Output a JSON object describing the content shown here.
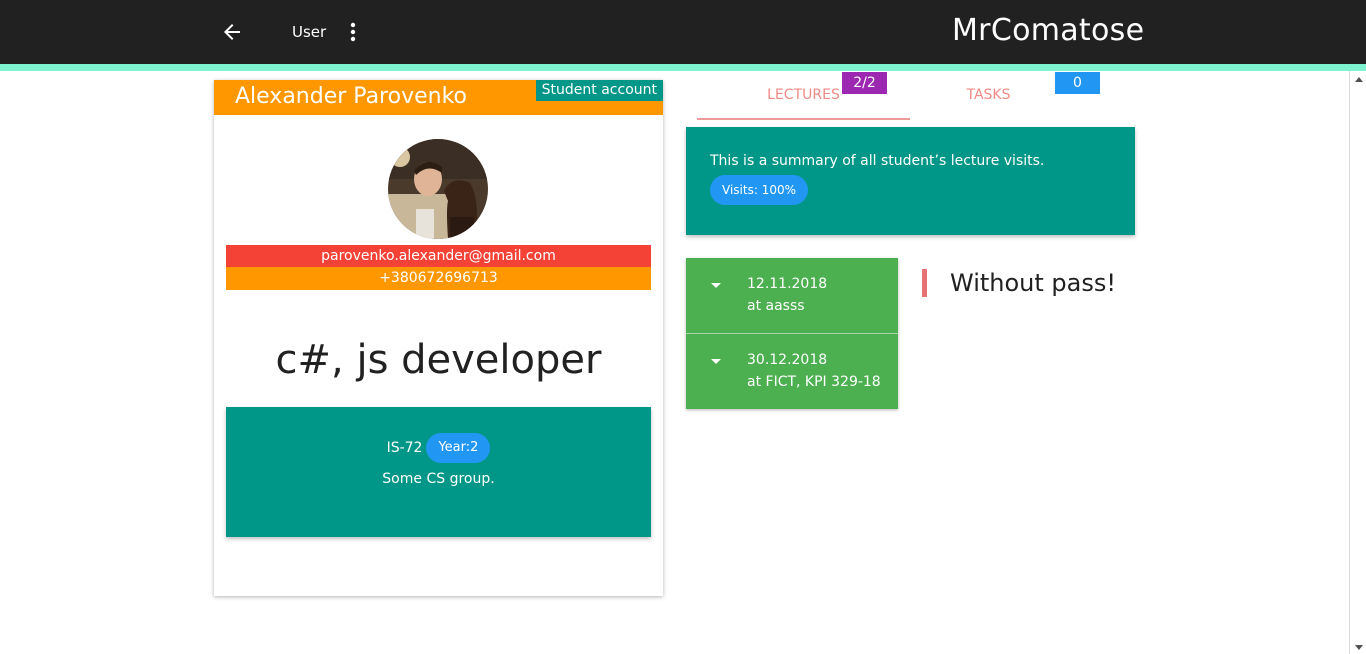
{
  "header": {
    "user_label": "User",
    "brand": "MrComatose"
  },
  "profile": {
    "name": "Alexander Parovenko",
    "account_badge": "Student account",
    "email": "parovenko.alexander@gmail.com",
    "phone": "+380672696713",
    "headline": "c#, js developer",
    "group": {
      "name": "IS-72",
      "year_chip": "Year:2",
      "description": "Some CS group."
    }
  },
  "tabs": [
    {
      "label": "LECTURES",
      "badge": "2/2"
    },
    {
      "label": "TASKS",
      "badge": "0"
    }
  ],
  "summary": {
    "text": "This is a summary of all student’s lecture visits.",
    "visits": "Visits: 100%"
  },
  "lectures": [
    {
      "date": "12.11.2018",
      "place": "at aasss"
    },
    {
      "date": "30.12.2018",
      "place": "at FICT, KPI 329-18"
    }
  ],
  "status_quote": "Without pass!",
  "colors": {
    "toolbar": "#212121",
    "accent_line": "#7ef3cf",
    "orange": "#ff9800",
    "teal": "#009688",
    "red": "#f44336",
    "blue": "#2196f3",
    "purple": "#9c27b0",
    "green": "#4caf50"
  },
  "icons": [
    "arrow-left-icon",
    "more-vert-icon",
    "caret-down-icon"
  ]
}
